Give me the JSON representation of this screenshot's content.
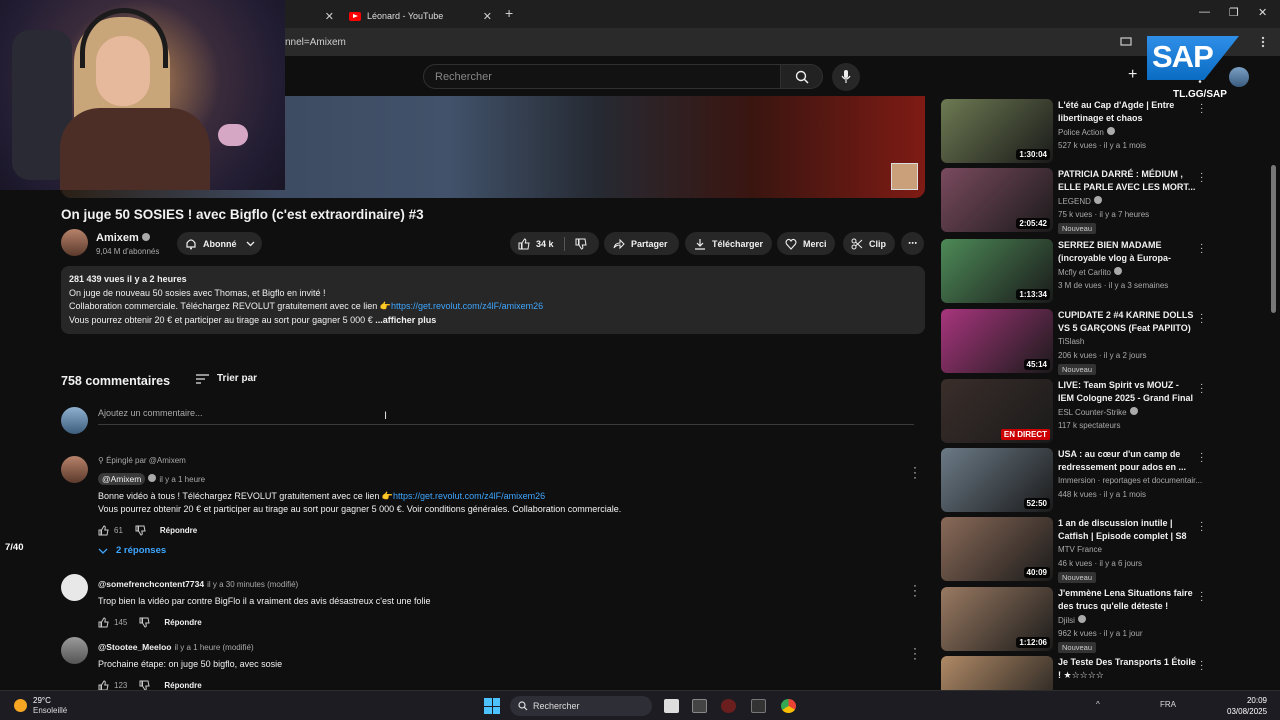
{
  "browser": {
    "tabs": [
      {
        "title": "",
        "close": "✕"
      },
      {
        "title": "Léonard - YouTube",
        "close": "✕"
      }
    ],
    "new_tab": "+",
    "address": "nnel=Amixem",
    "window_controls": [
      "—",
      "❐",
      "✕"
    ]
  },
  "masthead": {
    "search_placeholder": "Rechercher",
    "create": "+"
  },
  "overlay": {
    "sap_text": "SAP",
    "sap_tag": "TL.GG/SAP"
  },
  "video": {
    "title": "On juge 50 SOSIES ! avec Bigflo (c'est extraordinaire) #3",
    "channel": "Amixem",
    "subscribers": "9,04 M d'abonnés",
    "subscribe_state": "Abonné",
    "likes": "34 k",
    "share": "Partager",
    "download": "Télécharger",
    "thanks": "Merci",
    "clip": "Clip",
    "more": "⋯"
  },
  "description": {
    "meta": "281 439 vues  il y a 2 heures",
    "line1": "On juge de nouveau 50 sosies avec Thomas, et Bigflo en invité !",
    "line2_text": "Collaboration commerciale. Téléchargez REVOLUT gratuitement avec ce lien  👉",
    "line2_link": "https://get.revolut.com/z4lF/amixem26",
    "line3": "Vous pourrez obtenir 20 € et participer au tirage au sort pour gagner 5 000 €",
    "more": "...afficher plus"
  },
  "comments_section": {
    "count": "758 commentaires",
    "sort": "Trier par",
    "add_placeholder": "Ajoutez un commentaire..."
  },
  "comments": [
    {
      "pinned": "Épinglé par @Amixem",
      "author": "@Amixem",
      "time": "il y a 1 heure",
      "text1": "Bonne vidéo à tous ! Téléchargez REVOLUT gratuitement avec ce lien  👉",
      "link": "https://get.revolut.com/z4lF/amixem26",
      "text2": "Vous pourrez obtenir 20 € et participer au tirage au sort pour gagner 5 000 €. Voir conditions générales. Collaboration commerciale.",
      "likes": "61",
      "reply": "Répondre",
      "replies": "2 réponses"
    },
    {
      "author": "@somefrenchcontent7734",
      "time": "il y a 30 minutes (modifié)",
      "text": "Trop bien la vidéo par contre BigFlo il a vraiment des avis désastreux c'est une folie",
      "likes": "145",
      "reply": "Répondre"
    },
    {
      "author": "@Stootee_Meeloo",
      "time": "il y a 1 heure (modifié)",
      "text": "Prochaine étape: on juge 50 bigflo, avec sosie",
      "likes": "123",
      "reply": "Répondre"
    }
  ],
  "counter": "7/40",
  "recommendations": [
    {
      "title": "L'été au Cap d'Agde | Entre libertinage et chaos",
      "channel": "Police Action",
      "verified": true,
      "meta": "527 k vues · il y a 1 mois",
      "duration": "1:30:04",
      "new": "",
      "color": "#6d7a52"
    },
    {
      "title": "PATRICIA DARRÉ : MÉDIUM , ELLE PARLE AVEC LES MORT...",
      "channel": "LEGEND",
      "verified": true,
      "meta": "75 k vues · il y a 7 heures",
      "duration": "2:05:42",
      "new": "Nouveau",
      "color": "#7a4a5e"
    },
    {
      "title": "SERREZ BIEN MADAME (incroyable vlog à Europa-Park...",
      "channel": "Mcfly et Carlito",
      "verified": true,
      "meta": "3 M de vues · il y a 3 semaines",
      "duration": "1:13:34",
      "new": "",
      "color": "#4d8a57"
    },
    {
      "title": "CUPIDATE 2 #4 KARINE DOLLS VS 5 GARÇONS  (Feat PAPIITO)",
      "channel": "TiSlash",
      "verified": false,
      "meta": "206 k vues · il y a 2 jours",
      "duration": "45:14",
      "new": "Nouveau",
      "color": "#a8357d"
    },
    {
      "title": "LIVE: Team Spirit vs MOUZ - IEM Cologne 2025 - Grand Final",
      "channel": "ESL Counter-Strike",
      "verified": true,
      "meta": "117 k spectateurs",
      "duration": "EN DIRECT",
      "new": "",
      "color": "#3a2e2a",
      "live": true
    },
    {
      "title": "USA : au cœur d'un camp de redressement pour ados en ...",
      "channel": "Immersion · reportages et documentair...",
      "verified": false,
      "meta": "448 k vues · il y a 1 mois",
      "duration": "52:50",
      "new": "",
      "color": "#6b7a86"
    },
    {
      "title": "1 an de discussion inutile | Catfish | Episode complet | S8",
      "channel": "MTV France",
      "verified": false,
      "meta": "46 k vues · il y a 6 jours",
      "duration": "40:09",
      "new": "Nouveau",
      "color": "#8a6a58"
    },
    {
      "title": "J'emmène Lena Situations faire des trucs qu'elle déteste ! ZON...",
      "channel": "Djilsi",
      "verified": true,
      "meta": "962 k vues · il y a 1 jour",
      "duration": "1:12:06",
      "new": "Nouveau",
      "color": "#9a7a62"
    },
    {
      "title": "Je Teste Des Transports 1 Étoile ! ★☆☆☆☆",
      "channel": "",
      "verified": false,
      "meta": "",
      "duration": "",
      "new": "",
      "color": "#b08a66"
    }
  ],
  "taskbar": {
    "temp": "29°C",
    "condition": "Ensoleillé",
    "search": "Rechercher",
    "lang": "FRA",
    "time": "20:09",
    "date": "03/08/2025"
  }
}
